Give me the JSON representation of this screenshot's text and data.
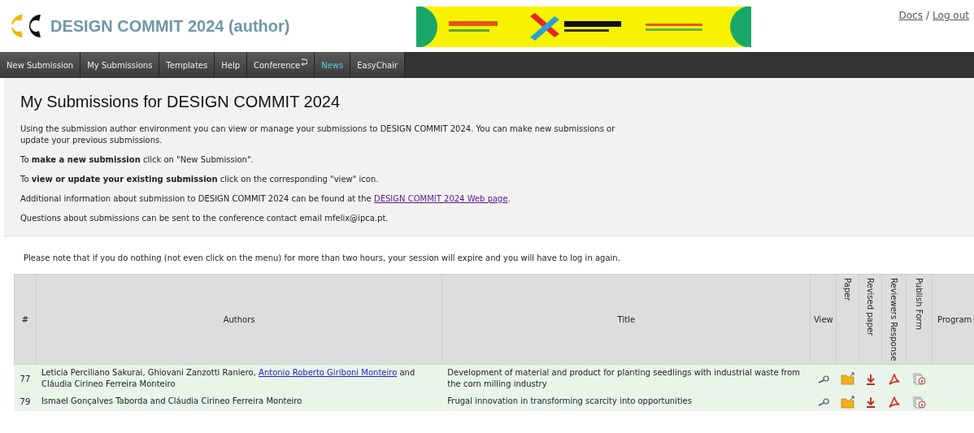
{
  "header": {
    "title": "DESIGN COMMIT 2024 (author)",
    "banner": {
      "kind": "picture"
    },
    "links": [
      "Docs",
      "Log out"
    ],
    "separator": "/"
  },
  "menu": [
    {
      "label": "New Submission",
      "selected": false,
      "external": false
    },
    {
      "label": "My Submissions",
      "selected": false,
      "external": false
    },
    {
      "label": "Templates",
      "selected": false,
      "external": false
    },
    {
      "label": "Help",
      "selected": false,
      "external": false
    },
    {
      "label": "Conference",
      "selected": false,
      "external": true
    },
    {
      "label": "News",
      "selected": true,
      "external": false
    },
    {
      "label": "EasyChair",
      "selected": false,
      "external": false
    }
  ],
  "intro": {
    "heading": "My Submissions for DESIGN COMMIT 2024",
    "paragraphs": [
      "Using the submission author environment you can view or manage your submissions to DESIGN COMMIT 2024. You can make new submissions or update your previous submissions.",
      "To **make a new submission** click on \"New Submission\".",
      "To **view or update your existing submission** click on the corresponding \"view\" icon."
    ],
    "web_page": {
      "before": "Additional information about submission to DESIGN COMMIT 2024 can be found at the ",
      "link": "DESIGN COMMIT 2024 Web page",
      "after": "."
    },
    "contact": "Questions about submissions can be sent to the conference contact email mfelix@ipca.pt."
  },
  "notice": "Please note that if you do nothing (not even click on the menu) for more than two hours, your session will expire and you will have to log in again.",
  "table": {
    "columns": [
      {
        "label": "#",
        "vertical": false
      },
      {
        "label": "Authors",
        "vertical": false
      },
      {
        "label": "Title",
        "vertical": false
      },
      {
        "label": "View",
        "vertical": false
      },
      {
        "label": "Paper",
        "vertical": true
      },
      {
        "label": "Revised paper",
        "vertical": true
      },
      {
        "label": "Reviewers Response",
        "vertical": true
      },
      {
        "label": "Publish Form",
        "vertical": true
      },
      {
        "label": "Program",
        "vertical": false
      }
    ],
    "rows": [
      {
        "number": "77",
        "authors": [
          {
            "text": "Leticia Perciliano Sakurai, Ghiovani Zanzotti Raniero, ",
            "linked": false
          },
          {
            "text": "Antonio Roberto Giriboni Monteiro",
            "linked": true
          },
          {
            "text": " and Cláudia Cirineo Ferreira Monteiro",
            "linked": false
          }
        ],
        "title": "Development of material and product for planting seedlings with industrial waste from the corn milling industry"
      },
      {
        "number": "79",
        "authors": [
          {
            "text": "Ismael Gonçalves Taborda and Cláudia Cirineo Ferreira Monteiro",
            "linked": false
          }
        ],
        "title": "Frugal innovation in transforming scarcity into opportunities"
      }
    ]
  }
}
